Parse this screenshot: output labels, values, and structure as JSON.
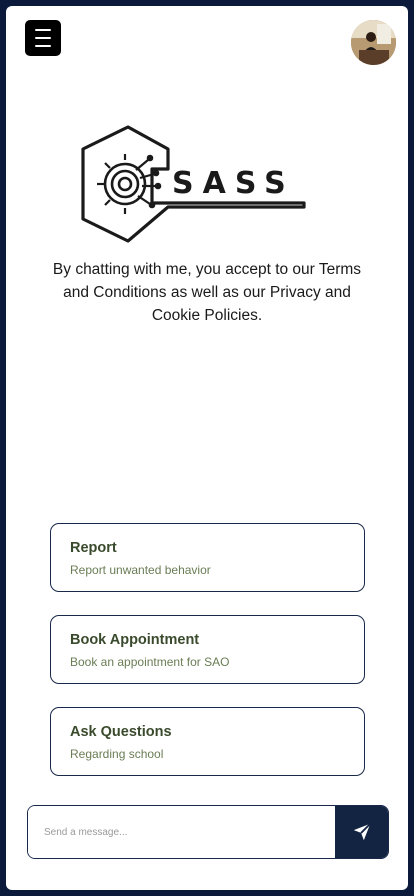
{
  "header": {
    "menu_icon": "hamburger-menu-icon",
    "avatar_icon": "user-avatar"
  },
  "brand": {
    "name": "SASS",
    "color": "#1a1a1a"
  },
  "intro": {
    "text": "By chatting with me, you accept to our Terms and Conditions as well as our Privacy and Cookie Policies."
  },
  "options": [
    {
      "title": "Report",
      "subtitle": "Report unwanted behavior"
    },
    {
      "title": "Book Appointment",
      "subtitle": "Book an appointment for SAO"
    },
    {
      "title": "Ask Questions",
      "subtitle": "Regarding school"
    }
  ],
  "composer": {
    "placeholder": "Send a message...",
    "send_icon": "send-icon"
  },
  "colors": {
    "page_background": "#0b1a3a",
    "accent": "#122441",
    "option_title": "#3a4a2c",
    "option_subtitle": "#6a7d55"
  }
}
